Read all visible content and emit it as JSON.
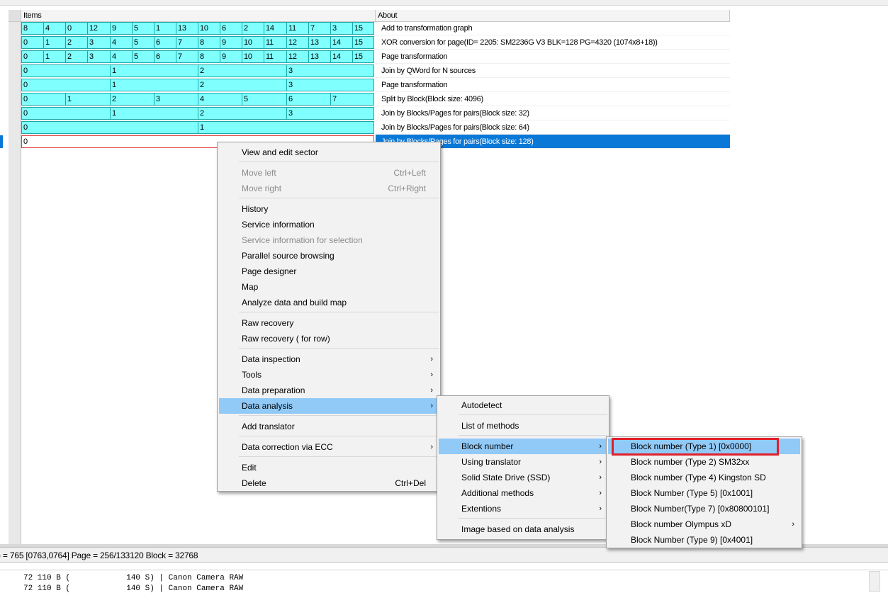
{
  "table": {
    "headers": {
      "items": "Items",
      "about": "About"
    },
    "rows": [
      {
        "cells": [
          "8",
          "4",
          "0",
          "12",
          "9",
          "5",
          "1",
          "13",
          "10",
          "6",
          "2",
          "14",
          "11",
          "7",
          "3",
          "15"
        ],
        "about": "Add to transformation graph"
      },
      {
        "cells": [
          "0",
          "1",
          "2",
          "3",
          "4",
          "5",
          "6",
          "7",
          "8",
          "9",
          "10",
          "11",
          "12",
          "13",
          "14",
          "15"
        ],
        "about": "XOR conversion for page(ID= 2205: SM2236G V3 BLK=128 PG=4320 (1074x8+18))"
      },
      {
        "cells": [
          "0",
          "1",
          "2",
          "3",
          "4",
          "5",
          "6",
          "7",
          "8",
          "9",
          "10",
          "11",
          "12",
          "13",
          "14",
          "15"
        ],
        "about": "Page transformation"
      },
      {
        "cells": [
          "0",
          "1",
          "2",
          "3"
        ],
        "about": "Join by QWord for N sources"
      },
      {
        "cells": [
          "0",
          "1",
          "2",
          "3"
        ],
        "about": "Page transformation"
      },
      {
        "cells": [
          "0",
          "1",
          "2",
          "3",
          "4",
          "5",
          "6",
          "7"
        ],
        "about": "Split by Block(Block size: 4096)"
      },
      {
        "cells": [
          "0",
          "1",
          "2",
          "3"
        ],
        "about": "Join by Blocks/Pages for pairs(Block size: 32)"
      },
      {
        "cells": [
          "0",
          "1"
        ],
        "about": "Join by Blocks/Pages for pairs(Block size: 64)"
      },
      {
        "cells": [
          "0"
        ],
        "about": "Join by Blocks/Pages for pairs(Block size: 128)",
        "selected": true
      }
    ]
  },
  "status_bar": {
    "text": ") = 765 [0763,0764] Page  = 256/133120 Block = 32768"
  },
  "bottom_panel": {
    "lines": [
      "     72 110 B (            140 S) | Canon Camera RAW",
      "     72 110 B (            140 S) | Canon Camera RAW"
    ]
  },
  "context_menu": {
    "groups": [
      [
        {
          "label": "View and edit sector"
        }
      ],
      [
        {
          "label": "Move left",
          "shortcut": "Ctrl+Left",
          "disabled": true
        },
        {
          "label": "Move right",
          "shortcut": "Ctrl+Right",
          "disabled": true
        }
      ],
      [
        {
          "label": "History"
        },
        {
          "label": "Service information"
        },
        {
          "label": "Service information for selection",
          "disabled": true
        },
        {
          "label": "Parallel source browsing"
        },
        {
          "label": "Page designer"
        },
        {
          "label": "Map"
        },
        {
          "label": "Analyze data and build map"
        }
      ],
      [
        {
          "label": "Raw recovery"
        },
        {
          "label": "Raw recovery ( for row)"
        }
      ],
      [
        {
          "label": "Data inspection",
          "submenu": true
        },
        {
          "label": "Tools",
          "submenu": true
        },
        {
          "label": "Data preparation",
          "submenu": true
        },
        {
          "label": "Data analysis",
          "submenu": true,
          "highlighted": true
        }
      ],
      [
        {
          "label": "Add translator"
        }
      ],
      [
        {
          "label": "Data correction via ECC",
          "submenu": true
        }
      ],
      [
        {
          "label": "Edit"
        },
        {
          "label": "Delete",
          "shortcut": "Ctrl+Del"
        }
      ]
    ]
  },
  "analysis_menu": {
    "groups": [
      [
        {
          "label": "Autodetect"
        }
      ],
      [
        {
          "label": "List of methods"
        }
      ],
      [
        {
          "label": "Block number",
          "submenu": true,
          "highlighted": true
        },
        {
          "label": "Using translator",
          "submenu": true
        },
        {
          "label": "Solid State Drive (SSD)",
          "submenu": true
        },
        {
          "label": "Additional methods",
          "submenu": true
        },
        {
          "label": "Extentions",
          "submenu": true
        }
      ],
      [
        {
          "label": "Image based on data analysis"
        }
      ]
    ]
  },
  "block_menu": {
    "items": [
      {
        "label": "Block number (Type 1) [0x0000]",
        "highlighted": true,
        "outlined": true
      },
      {
        "label": "Block number (Type 2) SM32xx"
      },
      {
        "label": "Block number (Type 4) Kingston SD"
      },
      {
        "label": "Block Number (Type 5) [0x1001]"
      },
      {
        "label": "Block Number(Type 7) [0x80800101]"
      },
      {
        "label": "Block number Olympus xD",
        "submenu": true
      },
      {
        "label": "Block Number (Type 9) [0x4001]"
      }
    ]
  },
  "colors": {
    "cell_fill": "#80ffff",
    "selection": "#0a78d7",
    "menu_highlight": "#91c9f7",
    "outline": "#e0202a"
  }
}
